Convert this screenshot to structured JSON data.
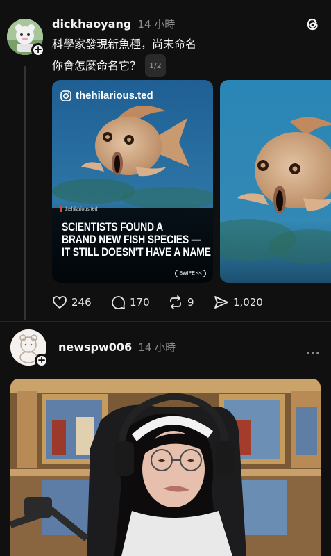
{
  "post1": {
    "username": "dickhaoyang",
    "time": "14 小時",
    "text_line1": "科學家發現新魚種，尚未命名",
    "text_line2": "你會怎麼命名它？",
    "page_indicator": "1/2",
    "card": {
      "account": "thehilarious.ted",
      "source": "thehilarious.ted",
      "headline_line1": "SCIENTISTS FOUND A",
      "headline_line2": "BRAND NEW FISH SPECIES —",
      "headline_line3": "IT STILL DOESN'T HAVE A NAME",
      "swipe_label": "SWIPE <<"
    },
    "stats": {
      "likes": "246",
      "comments": "170",
      "reposts": "9",
      "shares": "1,020"
    }
  },
  "post2": {
    "username": "newspw006",
    "time": "14 小時"
  },
  "colors": {
    "background": "#101010",
    "text": "#f3f5f7",
    "muted": "#8a8a8a",
    "card_blue": "#2e6f9e"
  }
}
